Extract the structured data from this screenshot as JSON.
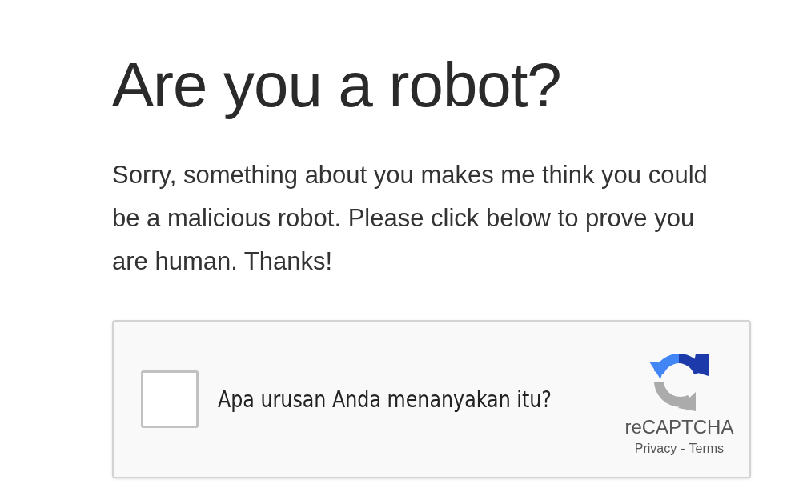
{
  "title": "Are you a robot?",
  "message": "Sorry, something about you makes me think you could be a malicious robot. Please click below to prove you are human. Thanks!",
  "captcha": {
    "checked": false,
    "label": "Apa urusan Anda menanyakan itu?",
    "brand": "reCAPTCHA",
    "links": [
      "Privacy",
      "Terms"
    ],
    "separator": "-"
  }
}
